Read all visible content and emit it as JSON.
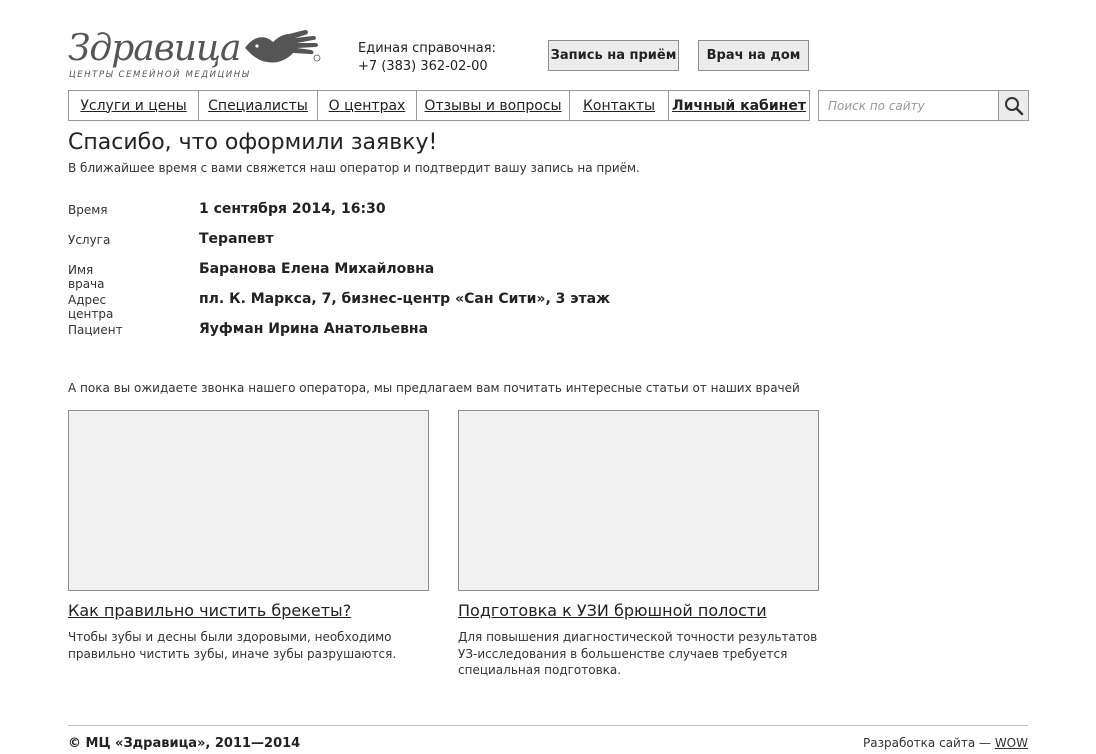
{
  "header": {
    "logo_text": "Здравица",
    "logo_tagline": "ЦЕНТРЫ СЕМЕЙНОЙ МЕДИЦИНЫ",
    "hotline_label": "Единая справочная:",
    "hotline_phone": "+7 (383) 362-02-00",
    "appointment_button": "Запись на приём",
    "home_doctor_button": "Врач на дом"
  },
  "nav": {
    "items": [
      {
        "label": "Услуги и цены"
      },
      {
        "label": "Специалисты"
      },
      {
        "label": "О центрах"
      },
      {
        "label": "Отзывы и вопросы"
      },
      {
        "label": "Контакты"
      },
      {
        "label": "Личный кабинет"
      }
    ]
  },
  "search": {
    "placeholder": "Поиск по сайту",
    "icon": "search-icon"
  },
  "confirmation": {
    "title": "Спасибо, что оформили заявку!",
    "subtitle": "В ближайшее время с вами свяжется наш оператор и подтвердит вашу запись на приём.",
    "rows": [
      {
        "label": "Время",
        "value": "1 сентября 2014, 16:30"
      },
      {
        "label": "Услуга",
        "value": "Терапевт"
      },
      {
        "label": "Имя врача",
        "value": "Баранова Елена Михайловна"
      },
      {
        "label": "Адрес центра",
        "value": "пл. К. Маркса, 7, бизнес-центр «Сан Сити», 3 этаж"
      },
      {
        "label": "Пациент",
        "value": "Яуфман Ирина Анатольевна"
      }
    ]
  },
  "articles": {
    "intro": "А пока вы ожидаете звонка нашего оператора, мы предлагаем вам почитать интересные статьи от наших врачей",
    "items": [
      {
        "title": "Как правильно чистить брекеты?",
        "text": "Чтобы зубы и десны были здоровыми, необходимо правильно чистить зубы, иначе зубы разрушаются."
      },
      {
        "title": "Подготовка к УЗИ брюшной полости",
        "text": "Для  повышения диагностической точности результатов УЗ-исследования в большенстве случаев требуется специальная подготовка."
      }
    ]
  },
  "footer": {
    "copyright": "© МЦ «Здравица», 2011—2014",
    "dev_label": "Разработка сайта — ",
    "dev_link": "WOW"
  },
  "colors": {
    "button_bg": "#ececec",
    "border": "#9a9a9a",
    "image_placeholder": "#f1f1f1",
    "text": "#222222"
  }
}
